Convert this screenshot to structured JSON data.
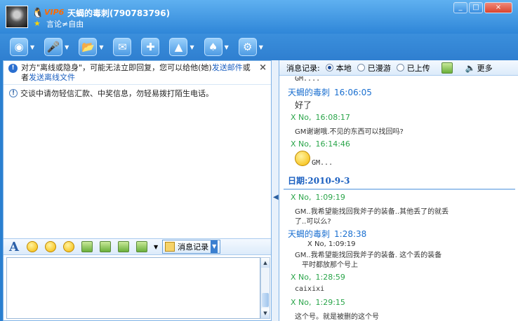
{
  "header": {
    "vip": "VIP6",
    "nickname": "天蝎的毒刺(790783796)",
    "signature": "言论≠自由",
    "window_buttons": [
      "_",
      "□",
      "×"
    ]
  },
  "toolbar": {
    "icons": [
      "webcam-icon",
      "mic-icon",
      "folder-icon",
      "mail-icon",
      "add-icon",
      "share-icon",
      "game-icon",
      "settings-icon"
    ],
    "glyphs": [
      "◉",
      "🎤",
      "📂",
      "✉",
      "✚",
      "▲",
      "♠",
      "⚙"
    ]
  },
  "notice": {
    "text_a": "对方\"离线或隐身\"，可能无法立即回复，您可以给他(她)",
    "link_a": "发送邮件",
    "text_b": "或者",
    "link_b": "发送离线文件",
    "close": "×"
  },
  "warning": "交谈中请勿轻信汇款、中奖信息，勿轻易拨打陌生电话。",
  "edit_toolbar": {
    "font_label": "A",
    "message_record_label": "消息记录"
  },
  "history": {
    "label": "消息记录:",
    "options": [
      "本地",
      "已漫游",
      "已上传"
    ],
    "more": "更多"
  },
  "log": {
    "l0": "GM....",
    "l1_sender": "天蝎的毒刺",
    "l1_time": "16:06:05",
    "l2": "好了",
    "l3_sender": "X No,",
    "l3_time": "16:08:17",
    "l4": "GM谢谢哦.不见的东西可以找回吗?",
    "l5_sender": "X No,",
    "l5_time": "16:14:46",
    "l6": "GM...",
    "date": "日期:2010-9-3",
    "l7_sender": "X No,",
    "l7_time": "1:09:19",
    "l8": "GM..我希望能找回我斧子的装备..其他丢了的就丢",
    "l9": "了..可以么?",
    "l10_sender": "天蝎的毒刺",
    "l10_time": "1:28:38",
    "l11": "X No, 1:09:19",
    "l12": "GM..我希望能找回我斧子的装备.     这个丢的装备",
    "l13": "平时都放那个号上",
    "l14_sender": "X No,",
    "l14_time": "1:28:59",
    "l15": "caixixi",
    "l16_sender": "X No,",
    "l16_time": "1:29:15",
    "l17": "这个号。就是被删的这个号"
  }
}
